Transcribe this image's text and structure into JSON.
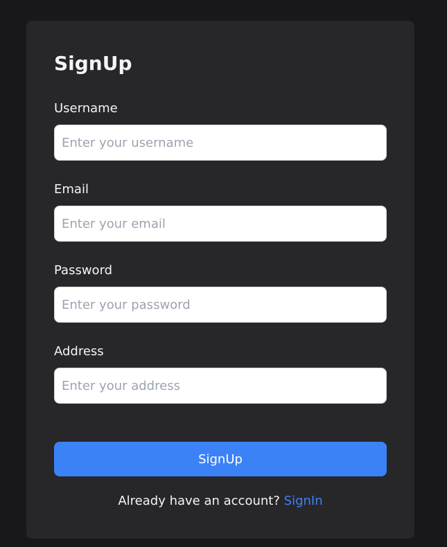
{
  "form": {
    "title": "SignUp",
    "fields": [
      {
        "label": "Username",
        "placeholder": "Enter your username",
        "value": ""
      },
      {
        "label": "Email",
        "placeholder": "Enter your email",
        "value": ""
      },
      {
        "label": "Password",
        "placeholder": "Enter your password",
        "value": ""
      },
      {
        "label": "Address",
        "placeholder": "Enter your address",
        "value": ""
      }
    ],
    "submit_label": "SignUp",
    "footer_text": "Already have an account?",
    "footer_link": "SignIn"
  },
  "colors": {
    "page_background": "#18181b",
    "card_background": "#27272a",
    "accent": "#3b82f6",
    "text": "#f4f4f5",
    "placeholder": "#9ca3af"
  }
}
